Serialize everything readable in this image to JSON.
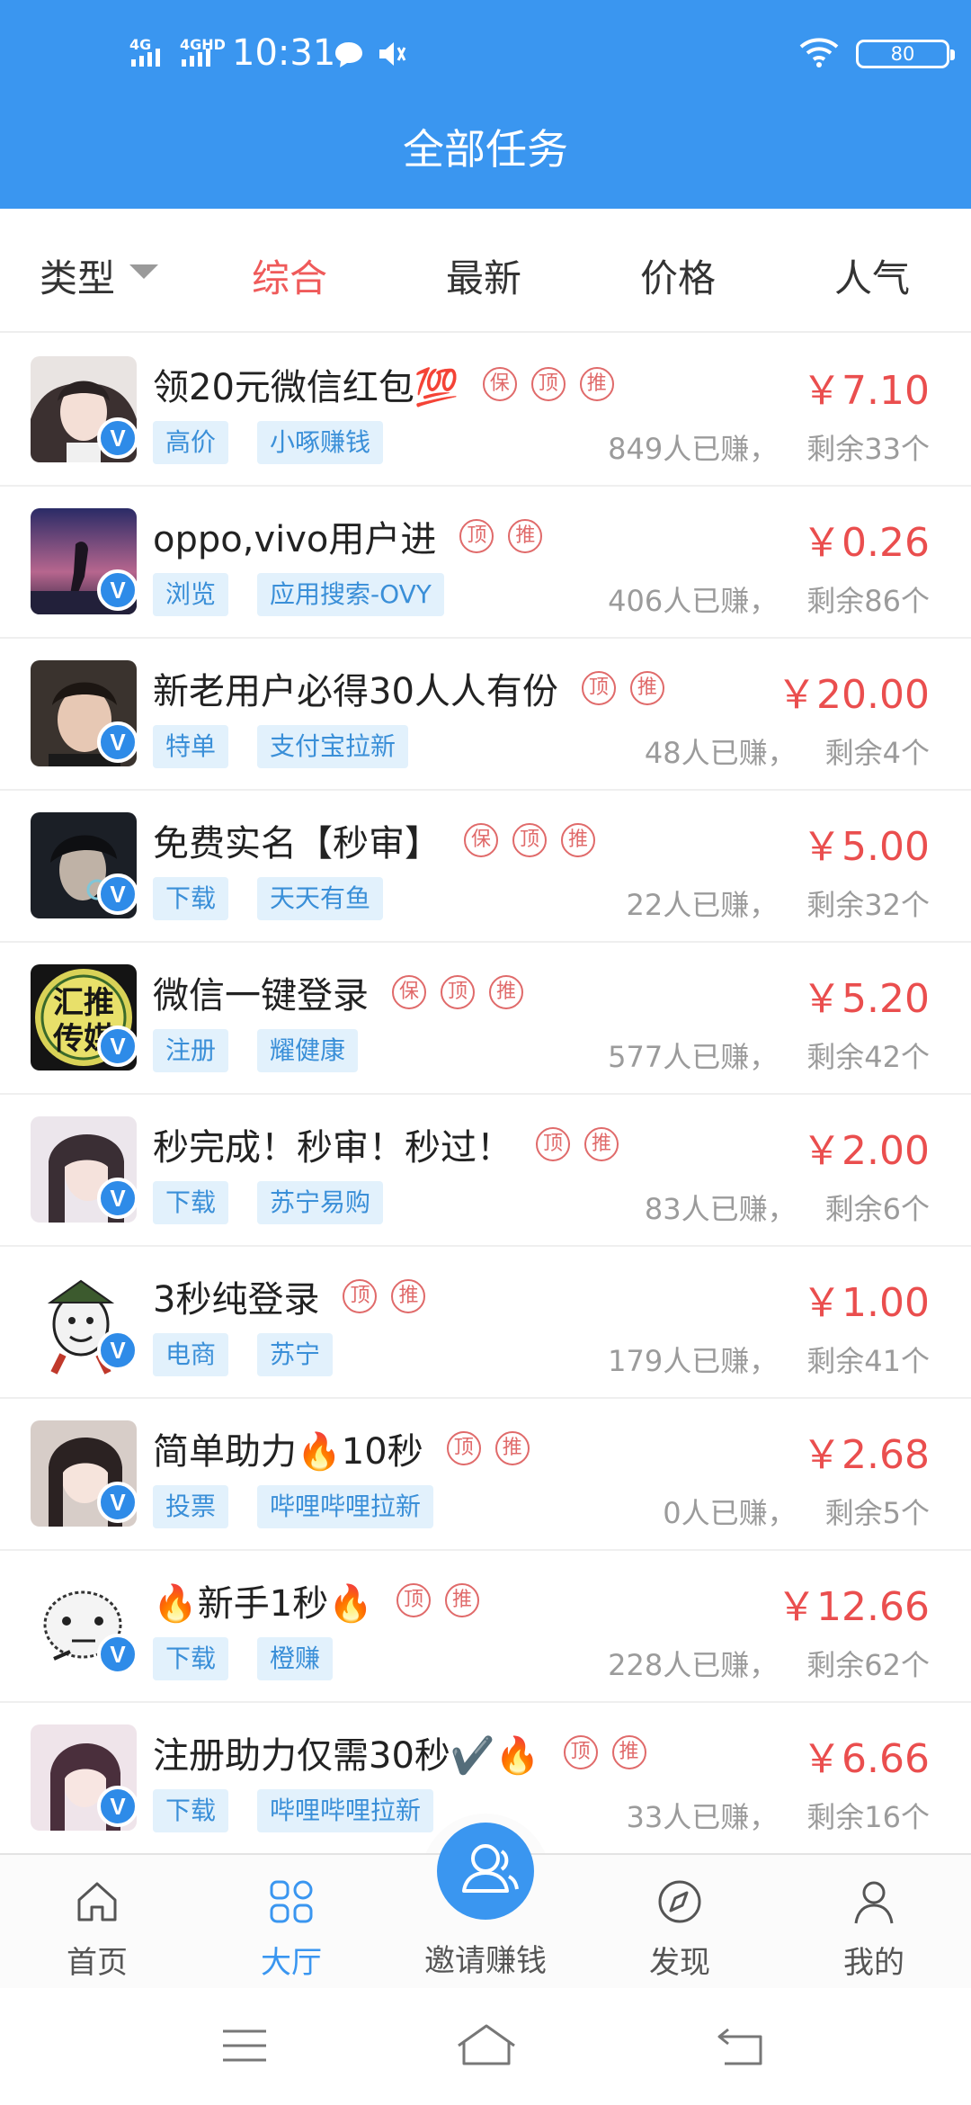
{
  "status_bar": {
    "signal1": "4G",
    "signal2": "4GHD",
    "time": "10:31",
    "battery": "80",
    "icons": [
      "message-icon",
      "volume-icon",
      "wifi-icon",
      "battery-icon"
    ]
  },
  "header": {
    "title": "全部任务",
    "color": "#3a96f0"
  },
  "filters": {
    "type": "类型",
    "comprehensive": "综合",
    "newest": "最新",
    "price": "价格",
    "popular": "人气"
  },
  "badges": {
    "bao": "保",
    "ding": "顶",
    "tui": "推",
    "verified": "V"
  },
  "tasks": [
    {
      "title": "领20元微信红包💯",
      "badges": [
        "保",
        "顶",
        "推"
      ],
      "price": "￥7.10",
      "tag1": "高价",
      "tag2": "小啄赚钱",
      "earned": "849人已赚，",
      "remain": "剩余33个"
    },
    {
      "title": "oppo,vivo用户进",
      "badges": [
        "顶",
        "推"
      ],
      "price": "￥0.26",
      "tag1": "浏览",
      "tag2": "应用搜索-OVY",
      "earned": "406人已赚，",
      "remain": "剩余86个"
    },
    {
      "title": "新老用户必得30人人有份",
      "badges": [
        "顶",
        "推"
      ],
      "price": "￥20.00",
      "tag1": "特单",
      "tag2": "支付宝拉新",
      "earned": "48人已赚，",
      "remain": "剩余4个"
    },
    {
      "title": "免费实名【秒审】",
      "badges": [
        "保",
        "顶",
        "推"
      ],
      "price": "￥5.00",
      "tag1": "下载",
      "tag2": "天天有鱼",
      "earned": "22人已赚，",
      "remain": "剩余32个"
    },
    {
      "title": "微信一键登录",
      "badges": [
        "保",
        "顶",
        "推"
      ],
      "price": "￥5.20",
      "tag1": "注册",
      "tag2": "耀健康",
      "earned": "577人已赚，",
      "remain": "剩余42个"
    },
    {
      "title": "秒完成！秒审！秒过！",
      "badges": [
        "顶",
        "推"
      ],
      "price": "￥2.00",
      "tag1": "下载",
      "tag2": "苏宁易购",
      "earned": "83人已赚，",
      "remain": "剩余6个"
    },
    {
      "title": "3秒纯登录",
      "badges": [
        "顶",
        "推"
      ],
      "price": "￥1.00",
      "tag1": "电商",
      "tag2": "苏宁",
      "earned": "179人已赚，",
      "remain": "剩余41个"
    },
    {
      "title": "简单助力🔥10秒",
      "badges": [
        "顶",
        "推"
      ],
      "price": "￥2.68",
      "tag1": "投票",
      "tag2": "哔哩哔哩拉新",
      "earned": "0人已赚，",
      "remain": "剩余5个"
    },
    {
      "title": "🔥新手1秒🔥",
      "badges": [
        "顶",
        "推"
      ],
      "price": "￥12.66",
      "tag1": "下载",
      "tag2": "橙赚",
      "earned": "228人已赚，",
      "remain": "剩余62个"
    },
    {
      "title": "注册助力仅需30秒✔️🔥",
      "badges": [
        "顶",
        "推"
      ],
      "price": "￥6.66",
      "tag1": "下载",
      "tag2": "哔哩哔哩拉新",
      "earned": "33人已赚，",
      "remain": "剩余16个"
    }
  ],
  "tabbar": {
    "home": "首页",
    "hall": "大厅",
    "invite": "邀请赚钱",
    "discover": "发现",
    "mine": "我的"
  },
  "avatar_text": {
    "row5_line1": "汇推",
    "row5_line2": "传媒"
  }
}
